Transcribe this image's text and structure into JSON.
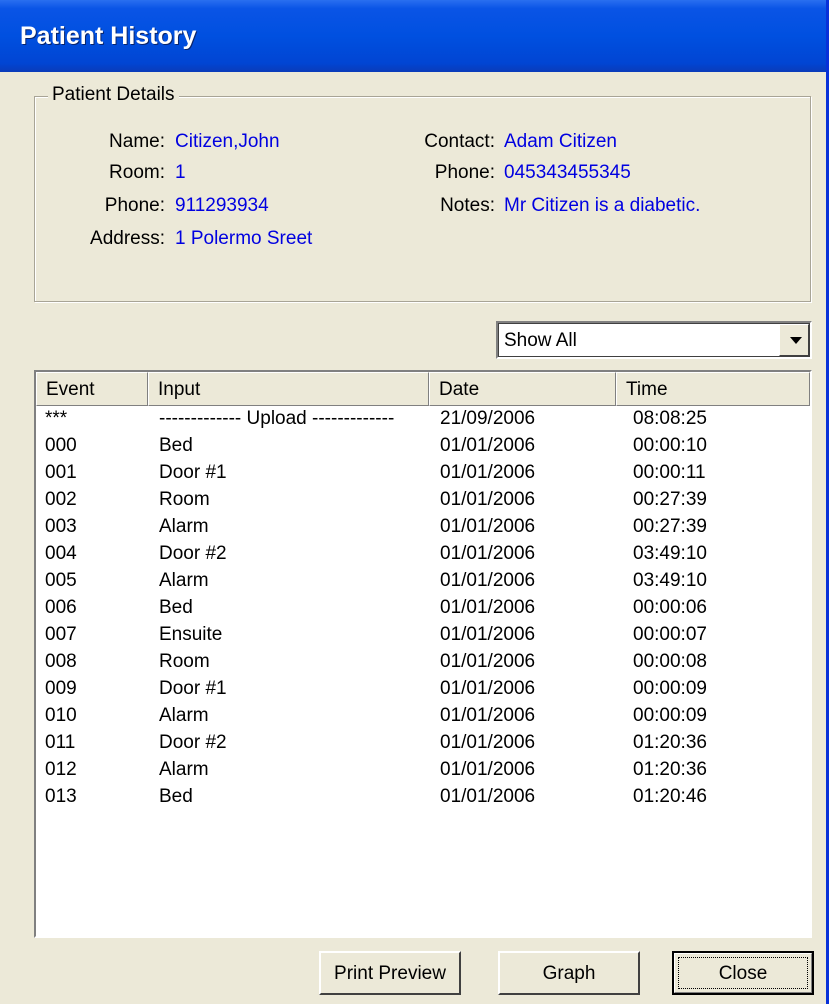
{
  "window": {
    "title": "Patient History"
  },
  "patient_details": {
    "legend": "Patient Details",
    "name_label": "Name:",
    "name": "Citizen,John",
    "room_label": "Room:",
    "room": "1",
    "phone_label": "Phone:",
    "phone": "911293934",
    "address_label": "Address:",
    "address": "1 Polermo Sreet",
    "contact_label": "Contact:",
    "contact": "Adam Citizen",
    "contact_phone_label": "Phone:",
    "contact_phone": "045343455345",
    "notes_label": "Notes:",
    "notes": "Mr Citizen is a diabetic."
  },
  "filter": {
    "selected": "Show All"
  },
  "table": {
    "columns": [
      "Event",
      "Input",
      "Date",
      "Time"
    ],
    "rows": [
      [
        "***",
        "------------- Upload -------------",
        "21/09/2006",
        "08:08:25"
      ],
      [
        "000",
        "Bed",
        "01/01/2006",
        "00:00:10"
      ],
      [
        "001",
        "Door #1",
        "01/01/2006",
        "00:00:11"
      ],
      [
        "002",
        "Room",
        "01/01/2006",
        "00:27:39"
      ],
      [
        "003",
        "Alarm",
        "01/01/2006",
        "00:27:39"
      ],
      [
        "004",
        "Door #2",
        "01/01/2006",
        "03:49:10"
      ],
      [
        "005",
        "Alarm",
        "01/01/2006",
        "03:49:10"
      ],
      [
        "006",
        "Bed",
        "01/01/2006",
        "00:00:06"
      ],
      [
        "007",
        "Ensuite",
        "01/01/2006",
        "00:00:07"
      ],
      [
        "008",
        "Room",
        "01/01/2006",
        "00:00:08"
      ],
      [
        "009",
        "Door #1",
        "01/01/2006",
        "00:00:09"
      ],
      [
        "010",
        "Alarm",
        "01/01/2006",
        "00:00:09"
      ],
      [
        "011",
        "Door #2",
        "01/01/2006",
        "01:20:36"
      ],
      [
        "012",
        "Alarm",
        "01/01/2006",
        "01:20:36"
      ],
      [
        "013",
        "Bed",
        "01/01/2006",
        "01:20:46"
      ]
    ]
  },
  "buttons": {
    "print_preview": "Print Preview",
    "graph": "Graph",
    "close": "Close"
  },
  "colors": {
    "title_bar": "#0050e0",
    "value_text": "#0000e0",
    "dialog_bg": "#ece9d8"
  }
}
